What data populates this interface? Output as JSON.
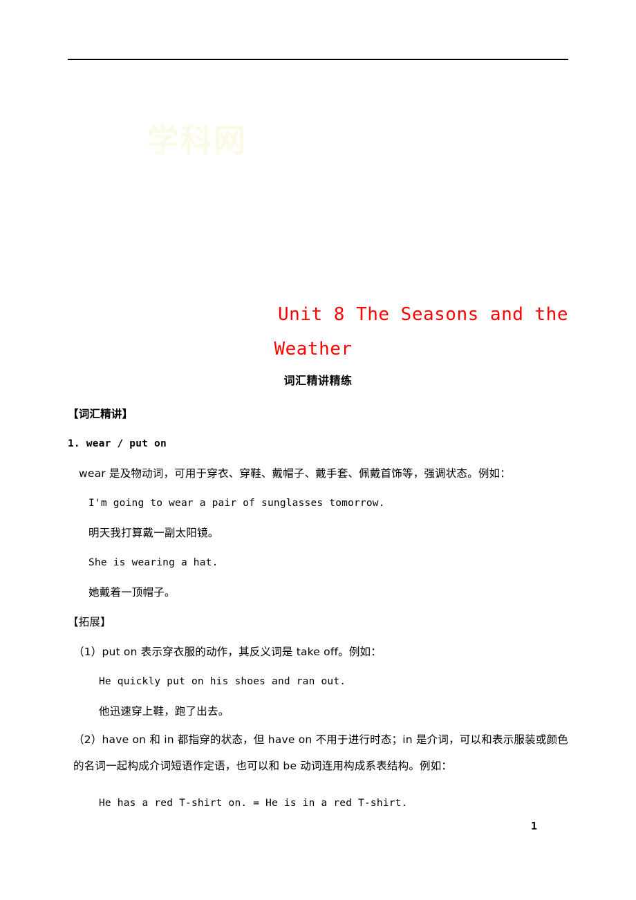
{
  "document": {
    "title_line1": "Unit 8 The Seasons and the",
    "title_line2": "Weather",
    "title_color": "#ff0000",
    "subtitle": "词汇精讲精练",
    "page_number": "1",
    "watermark_text": "学科网"
  },
  "sections": [
    {
      "heading": "【词汇精讲】",
      "entry_number": "1. wear / put on",
      "lines": [
        {
          "id": "l1",
          "text": "wear 是及物动词，可用于穿衣、穿鞋、戴帽子、戴手套、佩戴首饰等，强调状态。例如："
        },
        {
          "id": "l2",
          "text": "I'm going to wear a pair of sunglasses tomorrow."
        },
        {
          "id": "l3",
          "text": "明天我打算戴一副太阳镜。"
        },
        {
          "id": "l4",
          "text": "She is wearing a hat."
        },
        {
          "id": "l5",
          "text": "她戴着一顶帽子。"
        }
      ]
    },
    {
      "heading": "【拓展】",
      "lines": [
        {
          "id": "e1",
          "text": "（1）put on 表示穿衣服的动作，其反义词是 take off。例如："
        },
        {
          "id": "e2",
          "text": "He quickly put on his shoes and ran out."
        },
        {
          "id": "e3",
          "text": "他迅速穿上鞋，跑了出去。"
        },
        {
          "id": "e4",
          "text": "（2）have on 和 in 都指穿的状态，但 have on 不用于进行时态；in 是介词，可以和表示服装或颜色的名词一起构成介词短语作定语，也可以和 be 动词连用构成系表结构。例如："
        },
        {
          "id": "e5",
          "text": "He has a red T-shirt on. = He is in a red T-shirt."
        }
      ]
    }
  ]
}
